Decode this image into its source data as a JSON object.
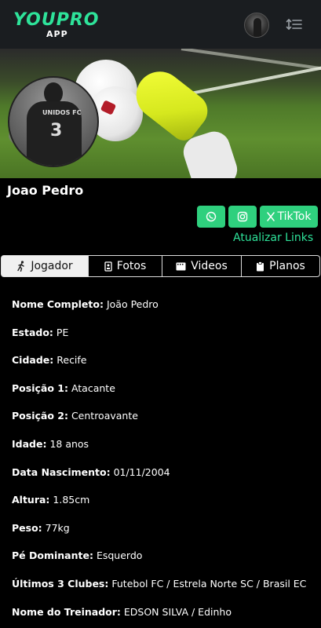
{
  "header": {
    "logo_text": "YOUPRO",
    "logo_sub": "APP",
    "avatar_icon": "avatar",
    "menu_icon": "sort-list-icon"
  },
  "profile": {
    "name": "Joao Pedro",
    "camera_icon": "camera-icon",
    "jersey_text": "UNIDOS FC",
    "jersey_number": "3"
  },
  "social": {
    "whatsapp_icon": "whatsapp-icon",
    "instagram_icon": "instagram-icon",
    "tiktok_label": "TikTok",
    "update_links": "Atualizar Links",
    "accent_color": "#2fd07e"
  },
  "tabs": [
    {
      "label": "Jogador",
      "icon": "running-person-icon",
      "active": true
    },
    {
      "label": "Fotos",
      "icon": "photo-card-icon",
      "active": false
    },
    {
      "label": "Videos",
      "icon": "film-icon",
      "active": false
    },
    {
      "label": "Planos",
      "icon": "clipboard-icon",
      "active": false
    }
  ],
  "details": [
    {
      "key": "Nome Completo:",
      "value": "João Pedro"
    },
    {
      "key": "Estado:",
      "value": "PE"
    },
    {
      "key": "Cidade:",
      "value": "Recife"
    },
    {
      "key": "Posição 1:",
      "value": "Atacante"
    },
    {
      "key": "Posição 2:",
      "value": "Centroavante"
    },
    {
      "key": "Idade:",
      "value": "18 anos"
    },
    {
      "key": "Data Nascimento:",
      "value": "01/11/2004"
    },
    {
      "key": "Altura:",
      "value": "1.85cm"
    },
    {
      "key": "Peso:",
      "value": "77kg"
    },
    {
      "key": "Pé Dominante:",
      "value": "Esquerdo"
    },
    {
      "key": "Últimos 3 Clubes:",
      "value": "Futebol FC / Estrela Norte SC / Brasil EC"
    },
    {
      "key": "Nome do Treinador:",
      "value": "EDSON SILVA / Edinho"
    }
  ]
}
